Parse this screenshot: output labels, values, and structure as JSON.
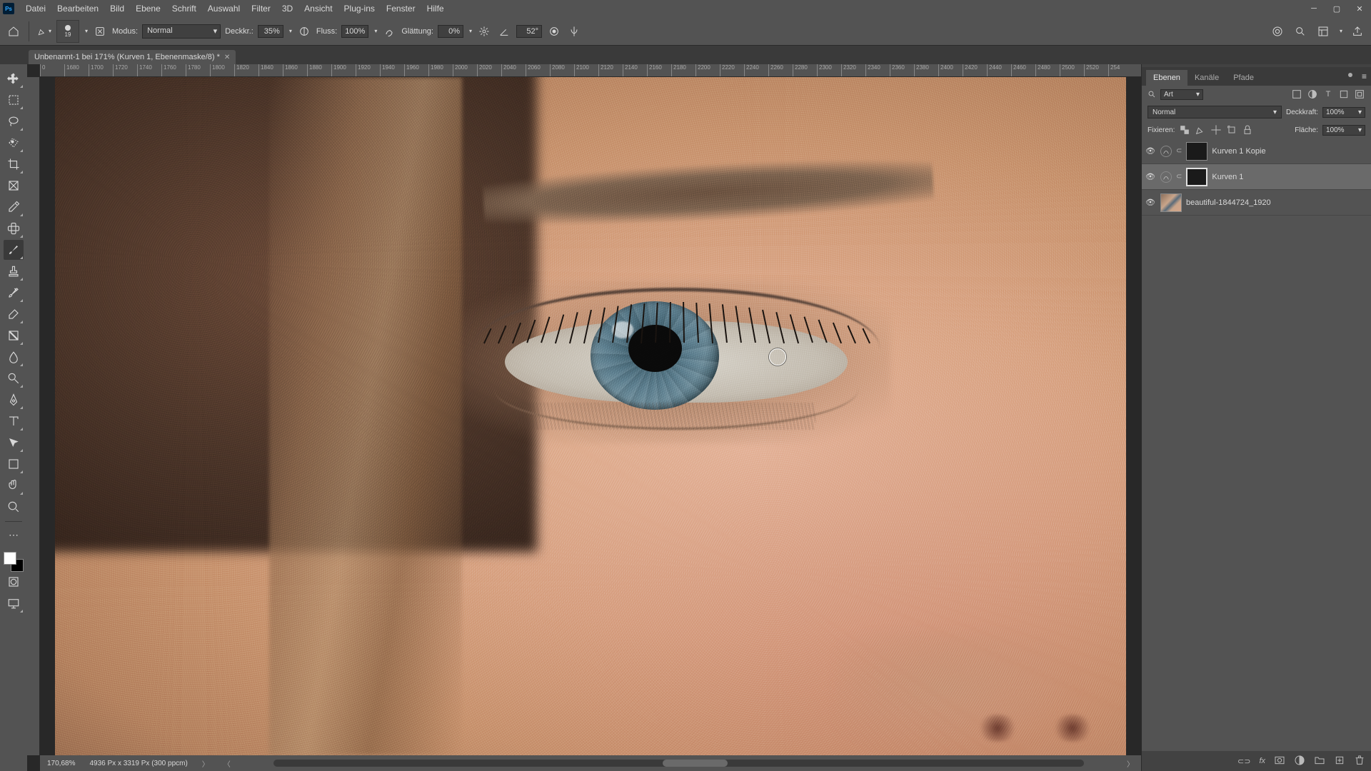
{
  "menu": {
    "items": [
      "Datei",
      "Bearbeiten",
      "Bild",
      "Ebene",
      "Schrift",
      "Auswahl",
      "Filter",
      "3D",
      "Ansicht",
      "Plug-ins",
      "Fenster",
      "Hilfe"
    ]
  },
  "options": {
    "brush_size": "19",
    "mode_label": "Modus:",
    "mode_value": "Normal",
    "opacity_label": "Deckkr.:",
    "opacity_value": "35%",
    "flow_label": "Fluss:",
    "flow_value": "100%",
    "smoothing_label": "Glättung:",
    "smoothing_value": "0%",
    "angle_value": "52°"
  },
  "document": {
    "tab_title": "Unbenannt-1 bei 171% (Kurven 1, Ebenenmaske/8) *"
  },
  "ruler": {
    "start": 0,
    "step": 20,
    "labels": [
      "0",
      "1680",
      "1700",
      "1720",
      "1740",
      "1760",
      "1780",
      "1800",
      "1820",
      "1840",
      "1860",
      "1880",
      "1900",
      "1920",
      "1940",
      "1960",
      "1980",
      "2000",
      "2020",
      "2040",
      "2060",
      "2080",
      "2100",
      "2120",
      "2140",
      "2160",
      "2180",
      "2200",
      "2220",
      "2240",
      "2260",
      "2280",
      "2300",
      "2320",
      "2340",
      "2360",
      "2380",
      "2400",
      "2420",
      "2440",
      "2460",
      "2480",
      "2500",
      "2520",
      "254"
    ]
  },
  "status": {
    "zoom": "170,68%",
    "doc_info": "4936 Px x 3319 Px (300 ppcm)"
  },
  "panels": {
    "tabs": [
      "Ebenen",
      "Kanäle",
      "Pfade"
    ],
    "filter_label": "Art",
    "blend_mode": "Normal",
    "opacity_label": "Deckkraft:",
    "opacity_value": "100%",
    "lock_label": "Fixieren:",
    "fill_label": "Fläche:",
    "fill_value": "100%"
  },
  "layers": [
    {
      "name": "Kurven 1 Kopie",
      "type": "adjustment",
      "selected": false
    },
    {
      "name": "Kurven 1",
      "type": "adjustment",
      "selected": true
    },
    {
      "name": "beautiful-1844724_1920",
      "type": "image",
      "selected": false
    }
  ]
}
